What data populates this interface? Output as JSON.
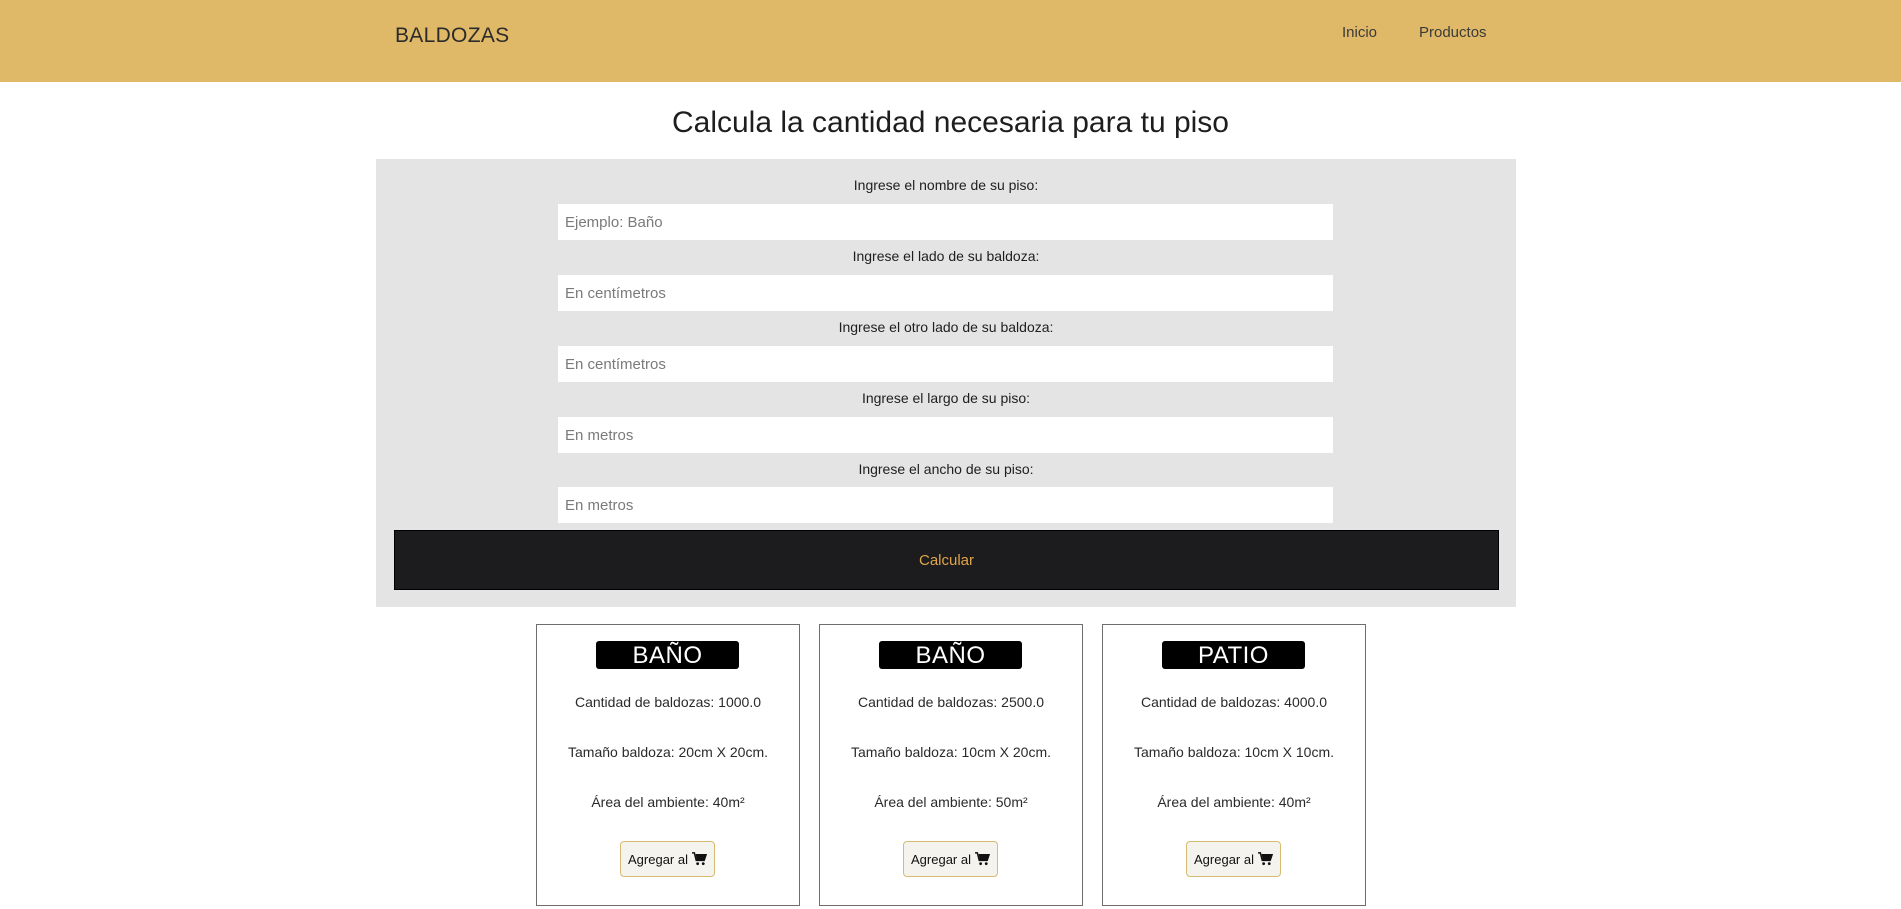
{
  "header": {
    "brand": "BALDOZAS",
    "nav": [
      "Inicio",
      "Productos"
    ],
    "background_color": "#dfb967"
  },
  "main": {
    "title": "Calcula la cantidad necesaria para tu piso"
  },
  "form": {
    "fields": [
      {
        "label": "Ingrese el nombre de su piso:",
        "placeholder": "Ejemplo: Baño",
        "value": ""
      },
      {
        "label": "Ingrese el lado de su baldoza:",
        "placeholder": "En centímetros",
        "value": ""
      },
      {
        "label": "Ingrese el otro lado de su baldoza:",
        "placeholder": "En centímetros",
        "value": ""
      },
      {
        "label": "Ingrese el largo de su piso:",
        "placeholder": "En metros",
        "value": ""
      },
      {
        "label": "Ingrese el ancho de su piso:",
        "placeholder": "En metros",
        "value": ""
      }
    ],
    "submit_label": "Calcular",
    "submit_text_color": "#e0a64a"
  },
  "cards": [
    {
      "title": "BAÑO",
      "quantity": "Cantidad de baldozas: 1000.0",
      "size": "Tamaño baldoza: 20cm X 20cm.",
      "area": "Área del ambiente: 40m²",
      "button_label": "Agregar al",
      "button_icon": "shopping-cart-icon"
    },
    {
      "title": "BAÑO",
      "quantity": "Cantidad de baldozas: 2500.0",
      "size": "Tamaño baldoza: 10cm X 20cm.",
      "area": "Área del ambiente: 50m²",
      "button_label": "Agregar al",
      "button_icon": "shopping-cart-icon"
    },
    {
      "title": "PATIO",
      "quantity": "Cantidad de baldozas: 4000.0",
      "size": "Tamaño baldoza: 10cm X 10cm.",
      "area": "Área del ambiente: 40m²",
      "button_label": "Agregar al",
      "button_icon": "shopping-cart-icon"
    }
  ]
}
